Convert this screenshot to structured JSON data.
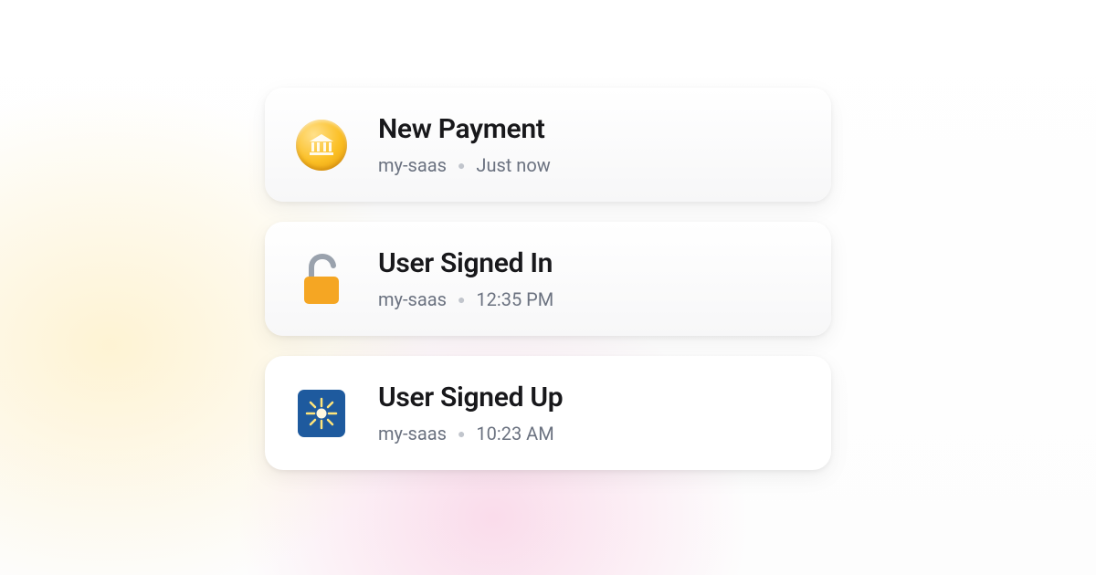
{
  "notifications": [
    {
      "icon": "coin-bank-icon",
      "title": "New Payment",
      "source": "my-saas",
      "time": "Just now"
    },
    {
      "icon": "unlocked-icon",
      "title": "User Signed In",
      "source": "my-saas",
      "time": "12:35 PM"
    },
    {
      "icon": "sparkle-badge-icon",
      "title": "User Signed Up",
      "source": "my-saas",
      "time": "10:23 AM"
    }
  ],
  "colors": {
    "coin_gold": "#fbbf24",
    "lock_orange": "#f59e0b",
    "badge_blue": "#1e5a9e",
    "text_primary": "#18181b",
    "text_secondary": "#6b7280"
  }
}
